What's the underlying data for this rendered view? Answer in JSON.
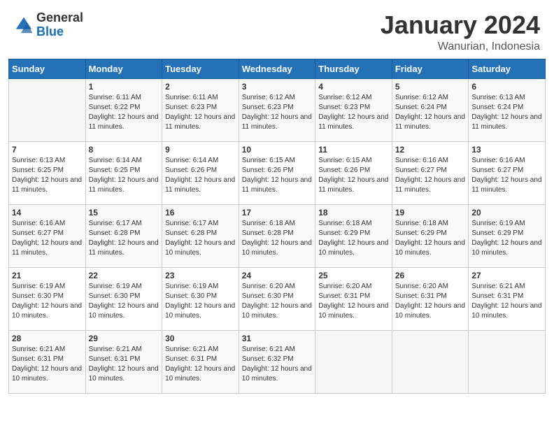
{
  "header": {
    "logo_general": "General",
    "logo_blue": "Blue",
    "month_year": "January 2024",
    "location": "Wanurian, Indonesia"
  },
  "calendar": {
    "days_of_week": [
      "Sunday",
      "Monday",
      "Tuesday",
      "Wednesday",
      "Thursday",
      "Friday",
      "Saturday"
    ],
    "weeks": [
      [
        {
          "day": "",
          "info": ""
        },
        {
          "day": "1",
          "info": "Sunrise: 6:11 AM\nSunset: 6:22 PM\nDaylight: 12 hours and 11 minutes."
        },
        {
          "day": "2",
          "info": "Sunrise: 6:11 AM\nSunset: 6:23 PM\nDaylight: 12 hours and 11 minutes."
        },
        {
          "day": "3",
          "info": "Sunrise: 6:12 AM\nSunset: 6:23 PM\nDaylight: 12 hours and 11 minutes."
        },
        {
          "day": "4",
          "info": "Sunrise: 6:12 AM\nSunset: 6:23 PM\nDaylight: 12 hours and 11 minutes."
        },
        {
          "day": "5",
          "info": "Sunrise: 6:12 AM\nSunset: 6:24 PM\nDaylight: 12 hours and 11 minutes."
        },
        {
          "day": "6",
          "info": "Sunrise: 6:13 AM\nSunset: 6:24 PM\nDaylight: 12 hours and 11 minutes."
        }
      ],
      [
        {
          "day": "7",
          "info": "Sunrise: 6:13 AM\nSunset: 6:25 PM\nDaylight: 12 hours and 11 minutes."
        },
        {
          "day": "8",
          "info": "Sunrise: 6:14 AM\nSunset: 6:25 PM\nDaylight: 12 hours and 11 minutes."
        },
        {
          "day": "9",
          "info": "Sunrise: 6:14 AM\nSunset: 6:26 PM\nDaylight: 12 hours and 11 minutes."
        },
        {
          "day": "10",
          "info": "Sunrise: 6:15 AM\nSunset: 6:26 PM\nDaylight: 12 hours and 11 minutes."
        },
        {
          "day": "11",
          "info": "Sunrise: 6:15 AM\nSunset: 6:26 PM\nDaylight: 12 hours and 11 minutes."
        },
        {
          "day": "12",
          "info": "Sunrise: 6:16 AM\nSunset: 6:27 PM\nDaylight: 12 hours and 11 minutes."
        },
        {
          "day": "13",
          "info": "Sunrise: 6:16 AM\nSunset: 6:27 PM\nDaylight: 12 hours and 11 minutes."
        }
      ],
      [
        {
          "day": "14",
          "info": "Sunrise: 6:16 AM\nSunset: 6:27 PM\nDaylight: 12 hours and 11 minutes."
        },
        {
          "day": "15",
          "info": "Sunrise: 6:17 AM\nSunset: 6:28 PM\nDaylight: 12 hours and 11 minutes."
        },
        {
          "day": "16",
          "info": "Sunrise: 6:17 AM\nSunset: 6:28 PM\nDaylight: 12 hours and 10 minutes."
        },
        {
          "day": "17",
          "info": "Sunrise: 6:18 AM\nSunset: 6:28 PM\nDaylight: 12 hours and 10 minutes."
        },
        {
          "day": "18",
          "info": "Sunrise: 6:18 AM\nSunset: 6:29 PM\nDaylight: 12 hours and 10 minutes."
        },
        {
          "day": "19",
          "info": "Sunrise: 6:18 AM\nSunset: 6:29 PM\nDaylight: 12 hours and 10 minutes."
        },
        {
          "day": "20",
          "info": "Sunrise: 6:19 AM\nSunset: 6:29 PM\nDaylight: 12 hours and 10 minutes."
        }
      ],
      [
        {
          "day": "21",
          "info": "Sunrise: 6:19 AM\nSunset: 6:30 PM\nDaylight: 12 hours and 10 minutes."
        },
        {
          "day": "22",
          "info": "Sunrise: 6:19 AM\nSunset: 6:30 PM\nDaylight: 12 hours and 10 minutes."
        },
        {
          "day": "23",
          "info": "Sunrise: 6:19 AM\nSunset: 6:30 PM\nDaylight: 12 hours and 10 minutes."
        },
        {
          "day": "24",
          "info": "Sunrise: 6:20 AM\nSunset: 6:30 PM\nDaylight: 12 hours and 10 minutes."
        },
        {
          "day": "25",
          "info": "Sunrise: 6:20 AM\nSunset: 6:31 PM\nDaylight: 12 hours and 10 minutes."
        },
        {
          "day": "26",
          "info": "Sunrise: 6:20 AM\nSunset: 6:31 PM\nDaylight: 12 hours and 10 minutes."
        },
        {
          "day": "27",
          "info": "Sunrise: 6:21 AM\nSunset: 6:31 PM\nDaylight: 12 hours and 10 minutes."
        }
      ],
      [
        {
          "day": "28",
          "info": "Sunrise: 6:21 AM\nSunset: 6:31 PM\nDaylight: 12 hours and 10 minutes."
        },
        {
          "day": "29",
          "info": "Sunrise: 6:21 AM\nSunset: 6:31 PM\nDaylight: 12 hours and 10 minutes."
        },
        {
          "day": "30",
          "info": "Sunrise: 6:21 AM\nSunset: 6:31 PM\nDaylight: 12 hours and 10 minutes."
        },
        {
          "day": "31",
          "info": "Sunrise: 6:21 AM\nSunset: 6:32 PM\nDaylight: 12 hours and 10 minutes."
        },
        {
          "day": "",
          "info": ""
        },
        {
          "day": "",
          "info": ""
        },
        {
          "day": "",
          "info": ""
        }
      ]
    ]
  }
}
